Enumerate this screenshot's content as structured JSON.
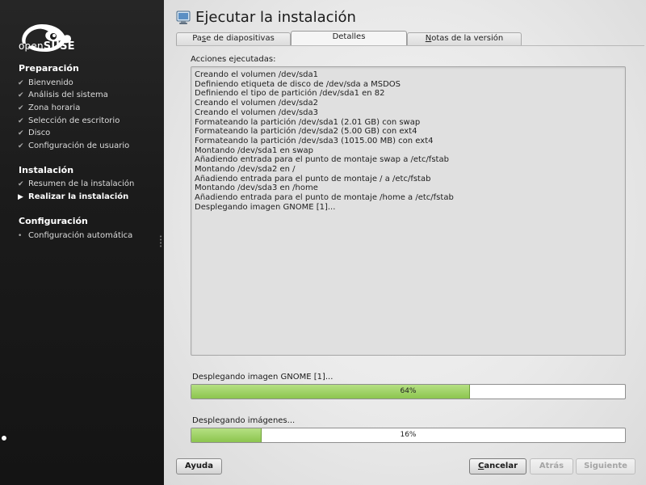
{
  "sidebar": {
    "brand": {
      "prefix": "open",
      "name": "SUSE"
    },
    "sections": [
      {
        "title": "Preparación",
        "steps": [
          {
            "label": "Bienvenido",
            "state": "done"
          },
          {
            "label": "Análisis del sistema",
            "state": "done"
          },
          {
            "label": "Zona horaria",
            "state": "done"
          },
          {
            "label": "Selección de escritorio",
            "state": "done"
          },
          {
            "label": "Disco",
            "state": "done"
          },
          {
            "label": "Configuración de usuario",
            "state": "done"
          }
        ]
      },
      {
        "title": "Instalación",
        "steps": [
          {
            "label": "Resumen de la instalación",
            "state": "done"
          },
          {
            "label": "Realizar la instalación",
            "state": "current"
          }
        ]
      },
      {
        "title": "Configuración",
        "steps": [
          {
            "label": "Configuración automática",
            "state": "pending"
          }
        ]
      }
    ],
    "icons": {
      "done": "check-icon",
      "current": "arrow-right-icon",
      "pending": "bullet-icon"
    }
  },
  "main": {
    "title": "Ejecutar la instalación",
    "title_icon": "monitor-icon",
    "tabs": [
      {
        "label": "Pase de diapositivas",
        "active": false
      },
      {
        "label": "Detalles",
        "active": true
      },
      {
        "label": "Notas de la versión",
        "active": false
      }
    ],
    "actions_label": "Acciones ejecutadas:",
    "log": [
      "Creando el volumen /dev/sda1",
      "Definiendo etiqueta de disco de /dev/sda a MSDOS",
      "Definiendo el tipo de partición /dev/sda1 en 82",
      "Creando el volumen /dev/sda2",
      "Creando el volumen /dev/sda3",
      "Formateando la partición /dev/sda1 (2.01 GB) con swap",
      "Formateando la partición /dev/sda2 (5.00 GB) con ext4",
      "Formateando la partición /dev/sda3 (1015.00 MB) con ext4",
      "Montando /dev/sda1 en swap",
      "Añadiendo entrada para el punto de montaje swap a /etc/fstab",
      "Montando /dev/sda2 en /",
      "Añadiendo entrada para el punto de montaje / a /etc/fstab",
      "Montando /dev/sda3 en /home",
      "Añadiendo entrada para el punto de montaje /home a /etc/fstab",
      "Desplegando imagen GNOME [1]..."
    ],
    "progress": [
      {
        "label": "Desplegando imagen GNOME [1]...",
        "percent": 64,
        "text": "64%"
      },
      {
        "label": "Desplegando imágenes...",
        "percent": 16,
        "text": "16%"
      }
    ]
  },
  "buttons": {
    "help": {
      "label": "Ayuda",
      "enabled": true
    },
    "cancel": {
      "label": "Cancelar",
      "enabled": true
    },
    "back": {
      "label": "Atrás",
      "enabled": false
    },
    "next": {
      "label": "Siguiente",
      "enabled": false
    }
  },
  "colors": {
    "sidebar_bg": "#1b1b1b",
    "progress_fill": "#8cc54e",
    "accent": "#73ba25"
  }
}
